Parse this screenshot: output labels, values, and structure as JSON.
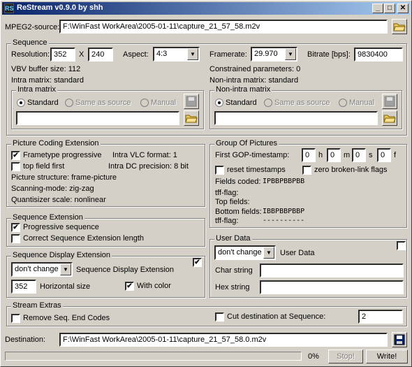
{
  "window": {
    "title": "ReStream v0.9.0 by shh",
    "app_icon_glyph": "RS"
  },
  "source": {
    "label": "MPEG2-source:",
    "path": "F:\\WinFast WorkArea\\2005-01-11\\capture_21_57_58.m2v"
  },
  "sequence": {
    "title": "Sequence",
    "resolution_label": "Resolution:",
    "width": "352",
    "x_label": "X",
    "height": "240",
    "aspect_label": "Aspect:",
    "aspect_value": "4:3",
    "framerate_label": "Framerate:",
    "framerate_value": "29.970",
    "bitrate_label": "Bitrate [bps]:",
    "bitrate_value": "9830400",
    "vbv_text": "VBV buffer size: 112",
    "constrained_text": "Constrained parameters: 0",
    "intra_matrix_text": "Intra matrix: standard",
    "non_intra_matrix_text": "Non-intra matrix: standard",
    "intra_group": {
      "title": "Intra matrix",
      "standard": "Standard",
      "same": "Same as source",
      "manual": "Manual",
      "file": ""
    },
    "nonintra_group": {
      "title": "Non-intra matrix",
      "standard": "Standard",
      "same": "Same as source",
      "manual": "Manual",
      "file": ""
    }
  },
  "pce": {
    "title": "Picture Coding Extension",
    "frametype": "Frametype progressive",
    "frametype_checked": true,
    "top_field_first": "top field first",
    "top_field_first_checked": false,
    "intra_vlc": "Intra VLC format: 1",
    "intra_dc": "Intra DC precision: 8 bit",
    "picture_structure": "Picture structure: frame-picture",
    "scanning_mode": "Scanning-mode: zig-zag",
    "quantizer": "Quantisizer scale: nonlinear"
  },
  "gop": {
    "title": "Group Of Pictures",
    "timestamp_label": "First GOP-timestamp:",
    "h": "0",
    "h_label": "h",
    "m": "0",
    "m_label": "m",
    "s": "0",
    "s_label": "s",
    "f": "0",
    "f_label": "f",
    "reset_ts": "reset timestamps",
    "zero_broken": "zero broken-link flags",
    "fields_coded_label": "Fields coded:",
    "fields_coded_value": "IPBBPBBPBB",
    "tff_label1": "tff-flag:",
    "tff_value1": "",
    "top_fields_label": "Top fields:",
    "top_fields_value": "",
    "bottom_fields_label": "Bottom fields:",
    "bottom_fields_value": "IBBPBBPBBP",
    "tff_label2": "tff-flag:",
    "tff_value2": "----------"
  },
  "seq_ext": {
    "title": "Sequence Extension",
    "progressive": "Progressive sequence",
    "progressive_checked": true,
    "correct_len": "Correct Sequence Extension length",
    "correct_len_checked": false
  },
  "user_data": {
    "title": "User Data",
    "mode": "don't change",
    "mode_label": "User Data",
    "char_label": "Char string",
    "char_value": "",
    "hex_label": "Hex string",
    "hex_value": ""
  },
  "sde": {
    "title": "Sequence Display Extension",
    "mode": "don't change",
    "mode_label": "Sequence Display Extension",
    "enabled_checked": true,
    "hsize": "352",
    "hsize_label": "Horizontal size",
    "with_color": "With color",
    "with_color_checked": true
  },
  "extras": {
    "title": "Stream Extras",
    "remove_end": "Remove Seq. End Codes",
    "remove_end_checked": false,
    "cut_dest": "Cut destination at Sequence:",
    "cut_dest_checked": false,
    "cut_value": "2"
  },
  "destination": {
    "label": "Destination:",
    "path": "F:\\WinFast WorkArea\\2005-01-11\\capture_21_57_58.0.m2v"
  },
  "footer": {
    "progress_percent": "0%",
    "progress_fraction": 0,
    "stop_label": "Stop!",
    "write_label": "Write!"
  },
  "check_glyph": "✔",
  "arrow_glyph": "▼",
  "colors": {
    "titlebar_start": "#0a246a",
    "titlebar_end": "#a6caf0",
    "face": "#d4d0c8"
  }
}
